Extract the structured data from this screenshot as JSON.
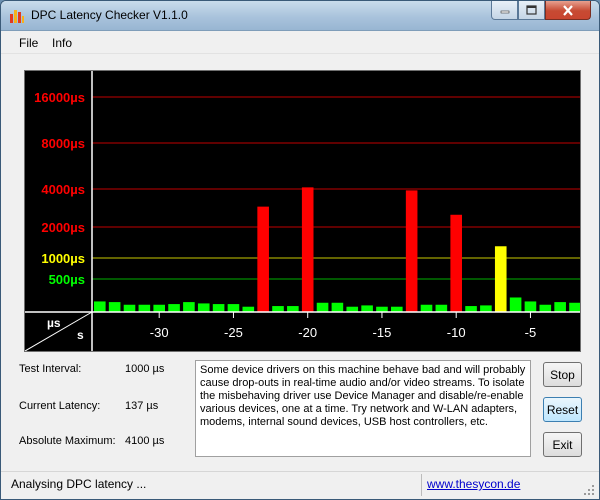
{
  "window": {
    "title": "DPC Latency Checker V1.1.0"
  },
  "menu": {
    "items": [
      "File",
      "Info"
    ]
  },
  "chart_data": {
    "type": "bar",
    "y_axis_labels": [
      "16000µs",
      "8000µs",
      "4000µs",
      "2000µs",
      "1000µs",
      "500µs"
    ],
    "y_axis_label_colors": [
      "#ff0000",
      "#ff0000",
      "#ff0000",
      "#ff0000",
      "#ffff00",
      "#00ff00"
    ],
    "x_ticks": [
      "-30",
      "-25",
      "-20",
      "-15",
      "-10",
      "-5"
    ],
    "axis_unit_top": "µs",
    "axis_unit_bottom": "s",
    "colors": {
      "green": "#00ff00",
      "yellow": "#ffff00",
      "red": "#ff0000",
      "background": "#000000"
    },
    "bars": [
      {
        "s": -34,
        "us": 160,
        "color": "green"
      },
      {
        "s": -33,
        "us": 150,
        "color": "green"
      },
      {
        "s": -32,
        "us": 110,
        "color": "green"
      },
      {
        "s": -31,
        "us": 110,
        "color": "green"
      },
      {
        "s": -30,
        "us": 110,
        "color": "green"
      },
      {
        "s": -29,
        "us": 120,
        "color": "green"
      },
      {
        "s": -28,
        "us": 150,
        "color": "green"
      },
      {
        "s": -27,
        "us": 130,
        "color": "green"
      },
      {
        "s": -26,
        "us": 120,
        "color": "green"
      },
      {
        "s": -25,
        "us": 120,
        "color": "green"
      },
      {
        "s": -24,
        "us": 80,
        "color": "green"
      },
      {
        "s": -23,
        "us": 2900,
        "color": "red"
      },
      {
        "s": -22,
        "us": 90,
        "color": "green"
      },
      {
        "s": -21,
        "us": 90,
        "color": "green"
      },
      {
        "s": -20,
        "us": 4100,
        "color": "red"
      },
      {
        "s": -19,
        "us": 140,
        "color": "green"
      },
      {
        "s": -18,
        "us": 140,
        "color": "green"
      },
      {
        "s": -17,
        "us": 80,
        "color": "green"
      },
      {
        "s": -16,
        "us": 100,
        "color": "green"
      },
      {
        "s": -15,
        "us": 80,
        "color": "green"
      },
      {
        "s": -14,
        "us": 80,
        "color": "green"
      },
      {
        "s": -13,
        "us": 3900,
        "color": "red"
      },
      {
        "s": -12,
        "us": 110,
        "color": "green"
      },
      {
        "s": -11,
        "us": 110,
        "color": "green"
      },
      {
        "s": -10,
        "us": 2500,
        "color": "red"
      },
      {
        "s": -9,
        "us": 90,
        "color": "green"
      },
      {
        "s": -8,
        "us": 100,
        "color": "green"
      },
      {
        "s": -7,
        "us": 1300,
        "color": "yellow"
      },
      {
        "s": -6,
        "us": 220,
        "color": "green"
      },
      {
        "s": -5,
        "us": 160,
        "color": "green"
      },
      {
        "s": -4,
        "us": 110,
        "color": "green"
      },
      {
        "s": -3,
        "us": 150,
        "color": "green"
      },
      {
        "s": -2,
        "us": 140,
        "color": "green"
      },
      {
        "s": -1,
        "us": 140,
        "color": "green"
      }
    ]
  },
  "info": {
    "test_interval_label": "Test Interval:",
    "test_interval_value": "1000 µs",
    "current_latency_label": "Current Latency:",
    "current_latency_value": "137 µs",
    "absolute_max_label": "Absolute Maximum:",
    "absolute_max_value": "4100 µs"
  },
  "message": "Some device drivers on this machine behave bad and will probably cause drop-outs in real-time audio and/or video streams. To isolate the misbehaving driver use Device Manager and disable/re-enable various devices, one at a time. Try network and W-LAN adapters, modems, internal sound devices, USB host controllers, etc.",
  "buttons": {
    "stop": "Stop",
    "reset": "Reset",
    "exit": "Exit"
  },
  "status": {
    "text": "Analysing DPC latency ...",
    "link": "www.thesycon.de"
  }
}
